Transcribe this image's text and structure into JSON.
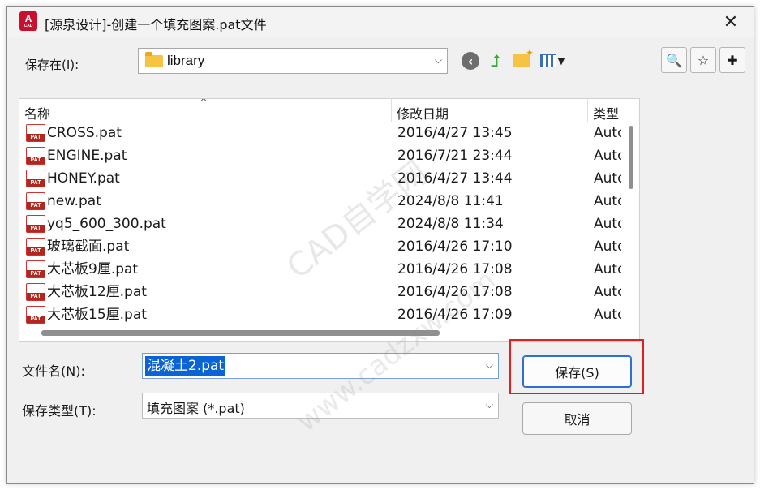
{
  "window": {
    "title": "[源泉设计]-创建一个填充图案.pat文件",
    "app_icon": {
      "letter": "A",
      "sub": "CAD"
    },
    "close_glyph": "✕"
  },
  "toolbar": {
    "savein_label": "保存在(I):",
    "location": "library",
    "dropdown_glyph": "⌵"
  },
  "filelist": {
    "columns": [
      "名称",
      "修改日期",
      "类型"
    ],
    "sort_glyph": "^",
    "files": [
      {
        "name": "CROSS.pat",
        "date": "2016/4/27 13:45",
        "type": "Autc"
      },
      {
        "name": "ENGINE.pat",
        "date": "2016/7/21 23:44",
        "type": "Autc"
      },
      {
        "name": "HONEY.pat",
        "date": "2016/4/27 13:44",
        "type": "Autc"
      },
      {
        "name": "new.pat",
        "date": "2024/8/8 11:41",
        "type": "Autc"
      },
      {
        "name": "yq5_600_300.pat",
        "date": "2024/8/8 11:34",
        "type": "Autc"
      },
      {
        "name": "玻璃截面.pat",
        "date": "2016/4/26 17:10",
        "type": "Autc"
      },
      {
        "name": "大芯板9厘.pat",
        "date": "2016/4/26 17:08",
        "type": "Autc"
      },
      {
        "name": "大芯板12厘.pat",
        "date": "2016/4/26 17:08",
        "type": "Autc"
      },
      {
        "name": "大芯板15厘.pat",
        "date": "2016/4/26 17:09",
        "type": "Autc"
      }
    ]
  },
  "form": {
    "filename_label": "文件名(N):",
    "filename_value": "混凝土2.pat",
    "filetype_label": "保存类型(T):",
    "filetype_value": "填充图案 (*.pat)"
  },
  "buttons": {
    "save": "保存(S)",
    "cancel": "取消"
  },
  "watermark": {
    "line1": "CAD自学网",
    "line2": "www.cadzxw.com"
  },
  "colors": {
    "highlight": "#e02020",
    "selection": "#0a64d6",
    "app_icon": "#c8102e"
  }
}
